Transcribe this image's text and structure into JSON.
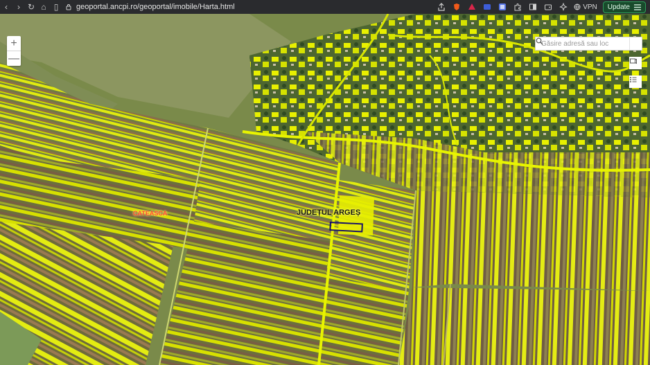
{
  "browser": {
    "url": "geoportal.ancpi.ro/geoportal/imobile/Harta.html",
    "vpn_label": "VPN",
    "update_label": "Update"
  },
  "map": {
    "zoom_in": "+",
    "zoom_out": "—",
    "search_placeholder": "Găsire adresă sau loc",
    "labels": {
      "locality": "CATEASCA",
      "county": "JUDEȚUL ARGEȘ"
    },
    "colors": {
      "parcel_yellow": "#e8f000",
      "parcel_outline": "#17116a",
      "locality_label": "#ff4a2b"
    }
  }
}
